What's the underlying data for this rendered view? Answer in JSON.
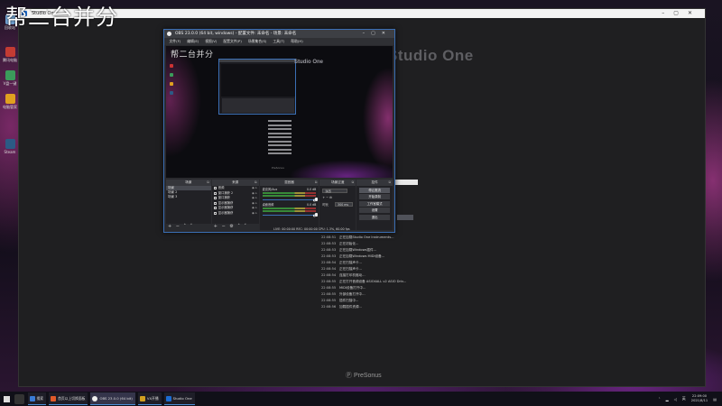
{
  "overlay": {
    "text": "帮二台并分"
  },
  "desktop_icons": [
    {
      "name": "recycle-bin",
      "label": "回收站",
      "color": "#6fa0d0"
    },
    {
      "name": "app-1",
      "label": "腾讯电脑",
      "color": "#c33b33"
    },
    {
      "name": "app-2",
      "label": "V盘一键",
      "color": "#3b9b5b"
    },
    {
      "name": "app-3",
      "label": "电脑管家",
      "color": "#e0a020"
    },
    {
      "name": "app-4",
      "label": "Steam",
      "color": "#2c5a85"
    }
  ],
  "studio": {
    "title": "Studio One",
    "logo": "Studio One",
    "footer_logo": "Ⓟ PreSonus",
    "button": "",
    "log": [
      {
        "time": "22:08:51",
        "msg": "正在加载Studio One Instruments..."
      },
      {
        "time": "22:08:53",
        "msg": "正在初始化..."
      },
      {
        "time": "22:08:53",
        "msg": "正在加载Windows插件..."
      },
      {
        "time": "22:08:53",
        "msg": "正在加载Windows MIDI设备..."
      },
      {
        "time": "22:08:54",
        "msg": "正在扫描声卡..."
      },
      {
        "time": "22:08:54",
        "msg": "正在扫描声卡..."
      },
      {
        "time": "22:08:54",
        "msg": "连接打印机驱动..."
      },
      {
        "time": "22:08:55",
        "msg": "正在打开音频设备 ASIO4ALL v2 ASIO Driv..."
      },
      {
        "time": "22:08:55",
        "msg": "MIDI设备打开中..."
      },
      {
        "time": "22:08:55",
        "msg": "外部设备打开中..."
      },
      {
        "time": "22:08:55",
        "msg": "插件扫描中..."
      },
      {
        "time": "22:08:56",
        "msg": "加载插件资源..."
      }
    ]
  },
  "obs": {
    "title": "OBS 23.0.0 (64 bit, windows) - 配置文件: 未命名 - 场景: 未命名",
    "menu": [
      "文件(F)",
      "编辑(E)",
      "视图(V)",
      "配置文件(P)",
      "场景集合(S)",
      "工具(T)",
      "帮助(H)"
    ],
    "preview": {
      "studio_logo": "Studio One",
      "footer": "PreSonus",
      "overlay_text": "帮二台并分"
    },
    "docks": {
      "scenes": {
        "title": "场景",
        "items": [
          "场景",
          "场景 2",
          "场景 3"
        ]
      },
      "sources": {
        "title": "来源",
        "items": [
          "音频",
          "窗口捕获 2",
          "窗口捕获",
          "显示器捕获",
          "显示器捕获",
          "显示器捕获"
        ]
      },
      "mixer": {
        "title": "混音器",
        "channels": [
          {
            "name": "麦克风/Aux",
            "db": "0.0 dB"
          },
          {
            "name": "桌面音频",
            "db": "0.0 dB"
          }
        ]
      },
      "transitions": {
        "title": "场景过渡",
        "mode": "淡出",
        "duration_label": "时长",
        "duration": "300 ms"
      },
      "controls": {
        "title": "控件",
        "buttons": [
          "停止推流",
          "开始录制",
          "工作室模式",
          "设置",
          "退出"
        ]
      }
    },
    "statusbar": "LIVE: 00:00:00   REC: 00:00:00   CPU: 1.3%, 60.00 fps"
  },
  "taskbar": {
    "tasks": [
      {
        "label": "搜索",
        "color": "#3a7bd5"
      },
      {
        "label": "首页以上切换面板",
        "color": "#e05a2a"
      },
      {
        "label": "OBS 23.0.0 (64 bit)",
        "color": "#222",
        "active": true
      },
      {
        "label": "VX开播",
        "color": "#d0a020"
      },
      {
        "label": "Studio One",
        "color": "#1c6cd1"
      }
    ],
    "time": "22:09:00",
    "date": "2021/8/11"
  }
}
